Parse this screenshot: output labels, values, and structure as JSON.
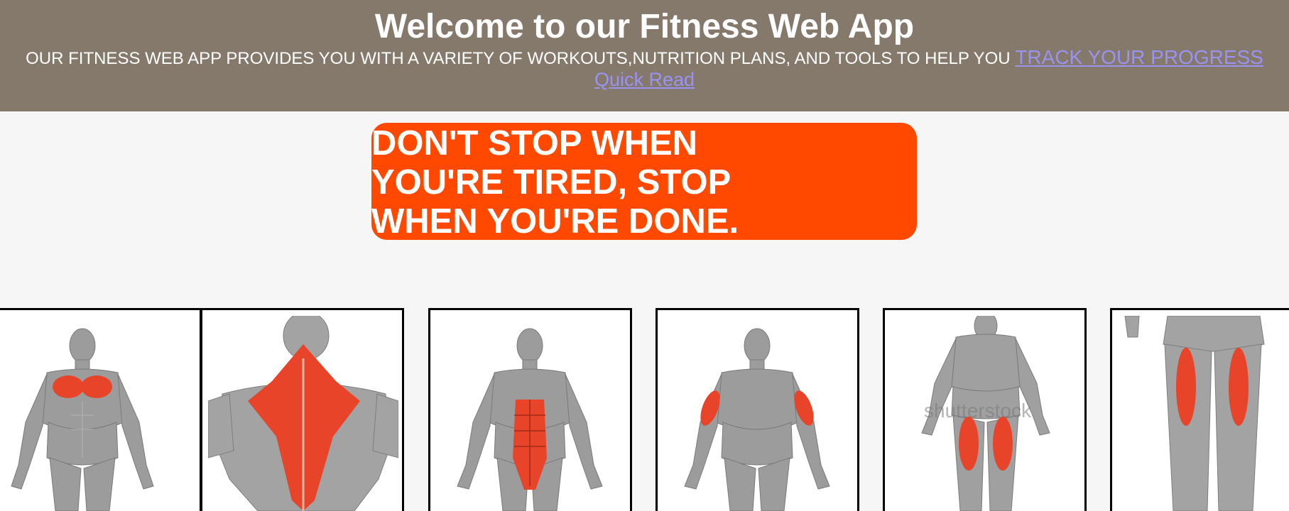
{
  "header": {
    "title": "Welcome to our Fitness Web App",
    "tagline": "OUR FITNESS WEB APP PROVIDES YOU WITH A VARIETY OF WORKOUTS,NUTRITION PLANS, AND TOOLS TO HELP YOU",
    "progress_link": "TRACK YOUR PROGRESS",
    "quick_read_link": "Quick Read"
  },
  "quote": {
    "text": "DON'T STOP WHEN YOU'RE TIRED, STOP WHEN YOU'RE DONE."
  },
  "colors": {
    "header_bg": "#84796b",
    "link": "#9a93f2",
    "quote_bg": "#ff4800",
    "muscle_highlight": "#e8442a"
  },
  "muscle_cards": [
    {
      "muscle": "chest",
      "watermark": ""
    },
    {
      "muscle": "back",
      "watermark": ""
    },
    {
      "muscle": "abs",
      "watermark": ""
    },
    {
      "muscle": "biceps",
      "watermark": ""
    },
    {
      "muscle": "quads",
      "watermark": "shutterstock"
    },
    {
      "muscle": "hamstrings",
      "watermark": ""
    }
  ]
}
